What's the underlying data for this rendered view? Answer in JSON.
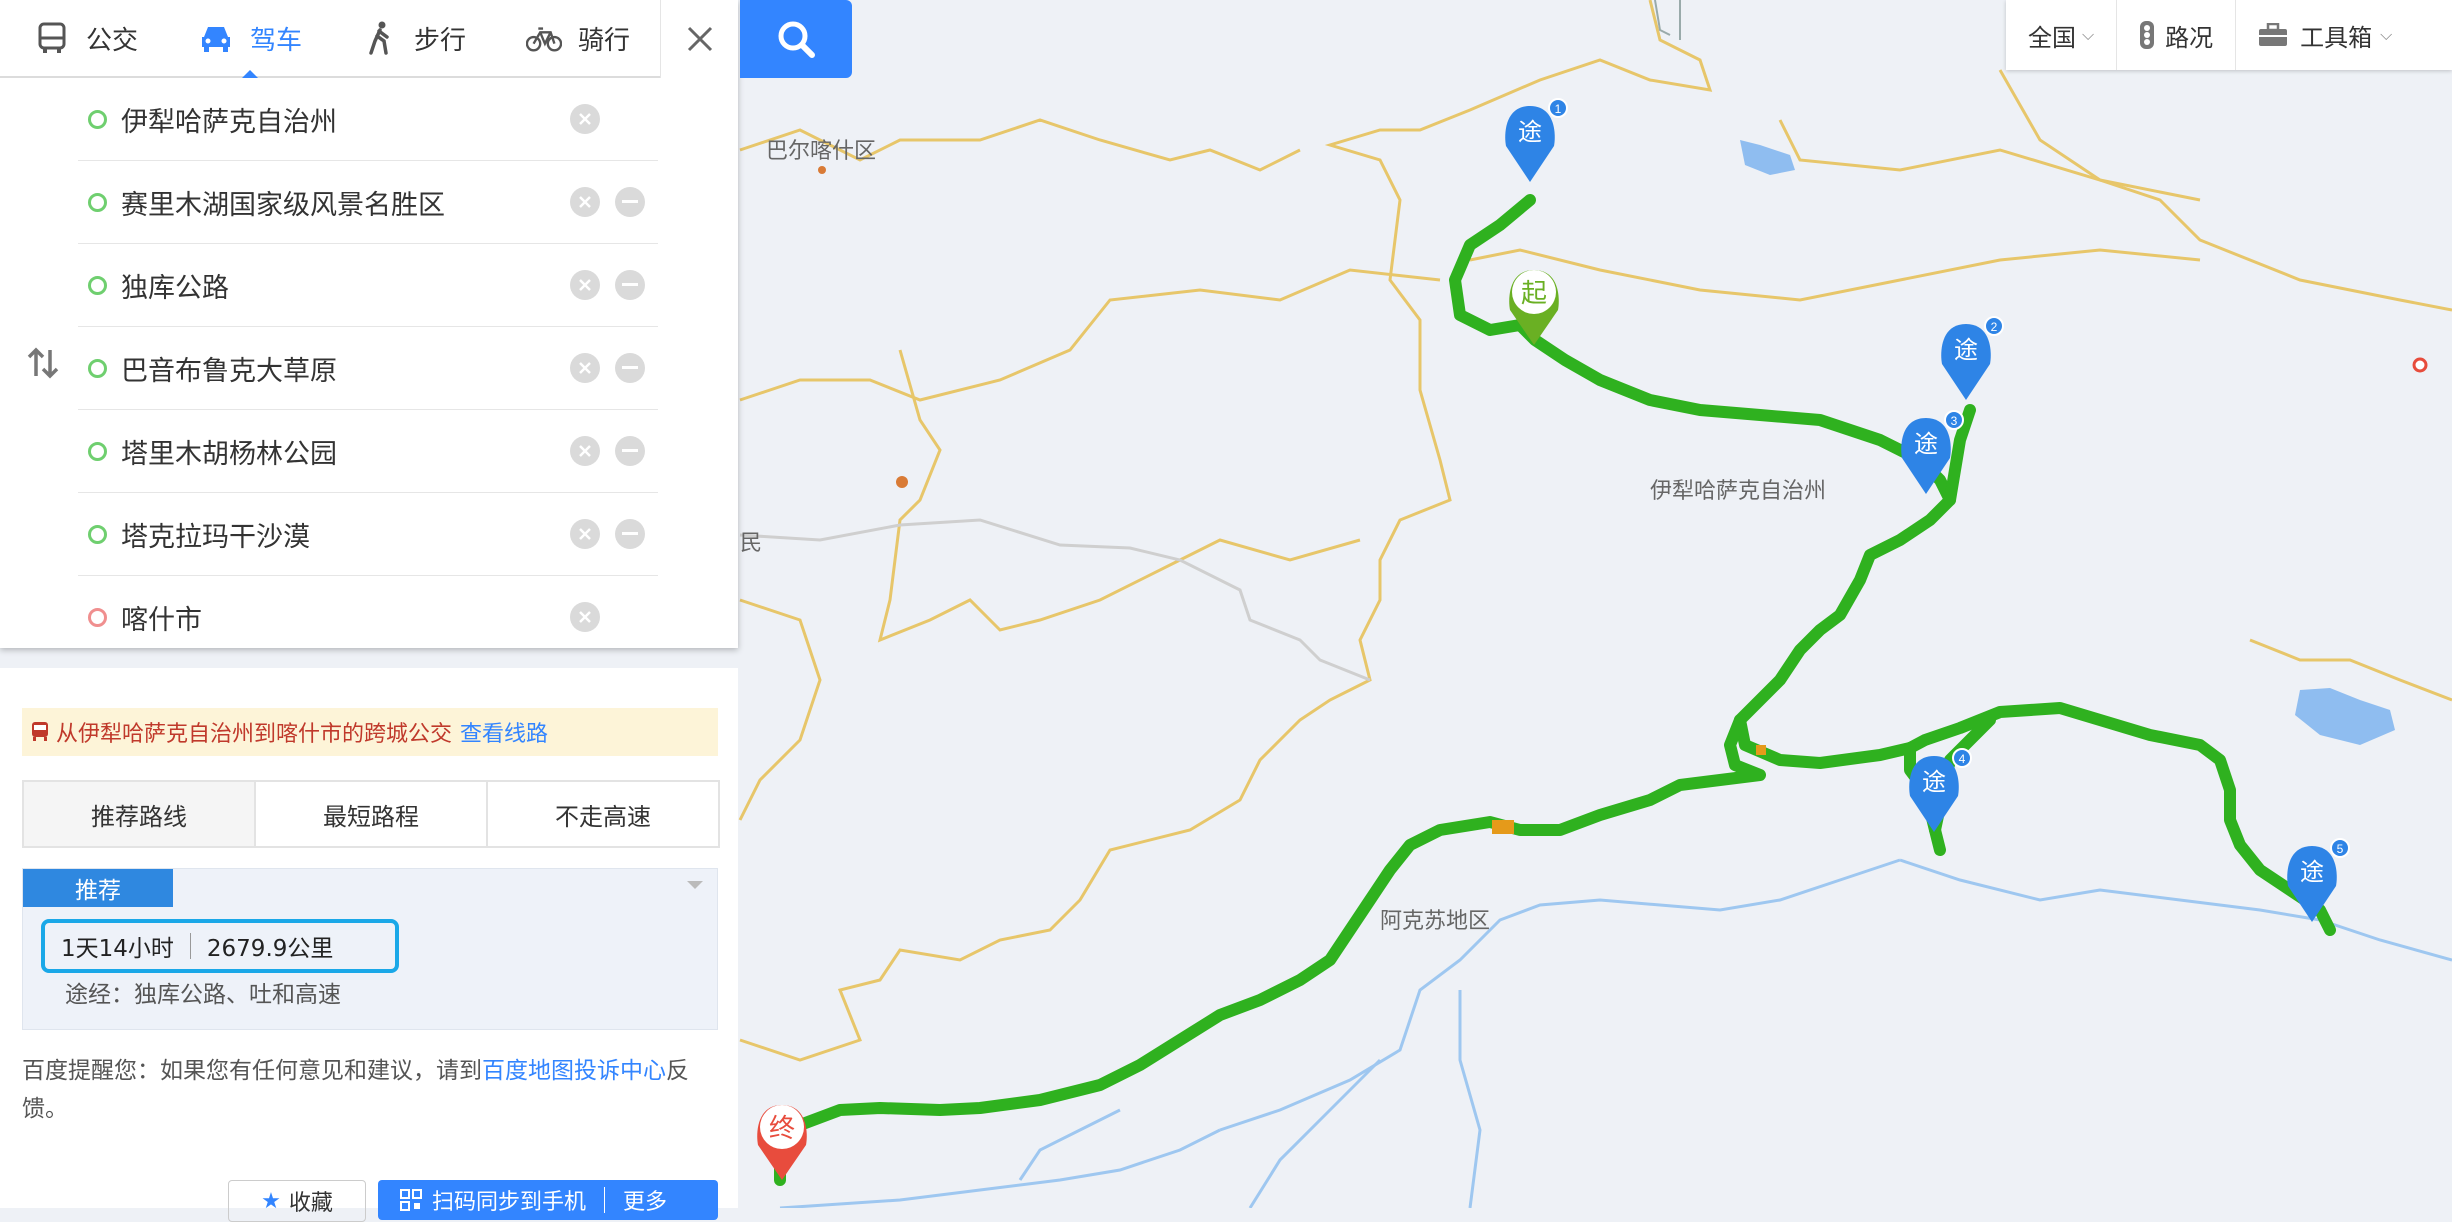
{
  "modes": [
    {
      "label": "公交",
      "icon": "bus-icon",
      "active": false
    },
    {
      "label": "驾车",
      "icon": "car-icon",
      "active": true
    },
    {
      "label": "步行",
      "icon": "walk-icon",
      "active": false
    },
    {
      "label": "骑行",
      "icon": "bike-icon",
      "active": false
    }
  ],
  "stops": [
    {
      "name": "伊犁哈萨克自治州",
      "type": "start"
    },
    {
      "name": "赛里木湖国家级风景名胜区",
      "type": "via"
    },
    {
      "name": "独库公路",
      "type": "via"
    },
    {
      "name": "巴音布鲁克大草原",
      "type": "via"
    },
    {
      "name": "塔里木胡杨林公园",
      "type": "via"
    },
    {
      "name": "塔克拉玛干沙漠",
      "type": "via"
    },
    {
      "name": "喀什市",
      "type": "end"
    }
  ],
  "bus_notice": {
    "text": "从伊犁哈萨克自治州到喀什市的跨城公交",
    "link": "查看线路"
  },
  "route_tabs": [
    "推荐路线",
    "最短路程",
    "不走高速"
  ],
  "route": {
    "badge": "推荐",
    "duration": "1天14小时",
    "distance": "2679.9公里",
    "via": "途经：独库公路、吐和高速"
  },
  "notice": {
    "prefix": "百度提醒您：如果您有任何意见和建议，请到",
    "link": "百度地图投诉中心",
    "suffix": "反馈。"
  },
  "actions": {
    "favorite": "收藏",
    "send_phone": "扫码同步到手机",
    "more": "更多"
  },
  "toolbar": {
    "region": "全国",
    "traffic": "路况",
    "tools": "工具箱"
  },
  "map_labels": {
    "baer": "巴尔喀什区",
    "yili": "伊犁哈萨克自治州",
    "akesu": "阿克苏地区",
    "min": "民"
  },
  "markers": {
    "start": "起",
    "end": "终",
    "via": "途",
    "via_numbers": [
      "1",
      "2",
      "3",
      "4",
      "5"
    ]
  },
  "colors": {
    "accent": "#3385ff",
    "route": "#2fb11f",
    "start": "#6ab023",
    "end": "#e84c3d",
    "via": "#2e84e6"
  }
}
